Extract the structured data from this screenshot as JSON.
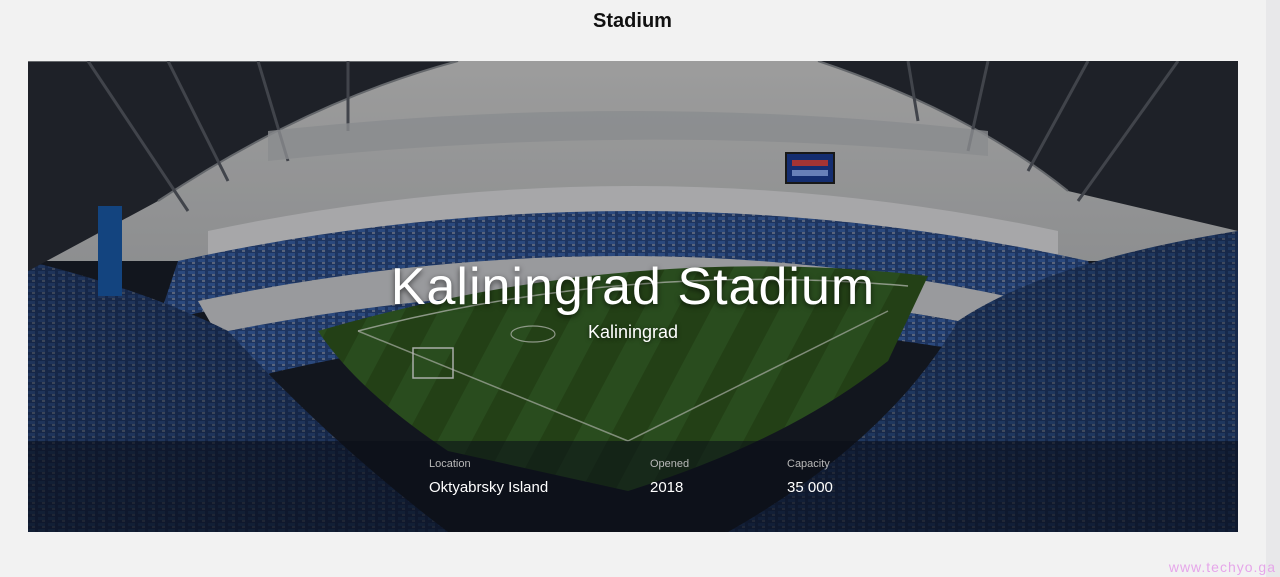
{
  "section": {
    "title": "Stadium"
  },
  "hero": {
    "stadium_name": "Kaliningrad Stadium",
    "city": "Kaliningrad",
    "image_icon": "stadium-photo"
  },
  "stats": [
    {
      "label": "Location",
      "value": "Oktyabrsky Island"
    },
    {
      "label": "Opened",
      "value": "2018"
    },
    {
      "label": "Capacity",
      "value": "35 000"
    }
  ],
  "watermark": "www.techyo.ga",
  "colors": {
    "page_background": "#f2f2f2",
    "pitch_green": "#2f5a24",
    "seat_blue": "#2b4f8f",
    "roof_dark": "#2a2f38",
    "watermark": "#e6a6ea"
  }
}
